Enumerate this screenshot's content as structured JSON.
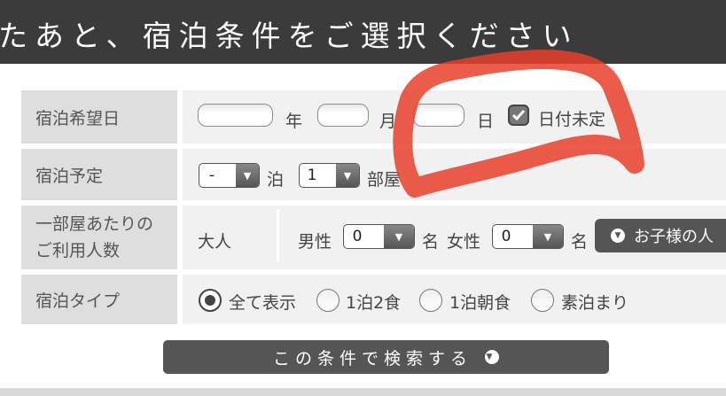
{
  "header": {
    "title": "たあと、宿泊条件をご選択ください"
  },
  "rows": {
    "date": {
      "label": "宿泊希望日",
      "year_unit": "年",
      "month_unit": "月",
      "day_unit": "日",
      "undecided_label": "日付未定",
      "undecided_checked": true
    },
    "plan": {
      "label": "宿泊予定",
      "nights_value": "-",
      "nights_unit": "泊",
      "rooms_value": "1",
      "rooms_unit": "部屋"
    },
    "guests": {
      "label_line1": "一部屋あたりの",
      "label_line2": "ご利用人数",
      "adult_label": "大人",
      "male_label": "男性",
      "male_value": "0",
      "female_label": "女性",
      "female_value": "0",
      "count_unit": "名",
      "kids_button": "お子様の人"
    },
    "type": {
      "label": "宿泊タイプ",
      "options": [
        "全て表示",
        "1泊2食",
        "1泊朝食",
        "素泊まり"
      ],
      "selected": "全て表示"
    }
  },
  "search_button": "この条件で検索する",
  "annotation": {
    "color": "#e8402a"
  }
}
